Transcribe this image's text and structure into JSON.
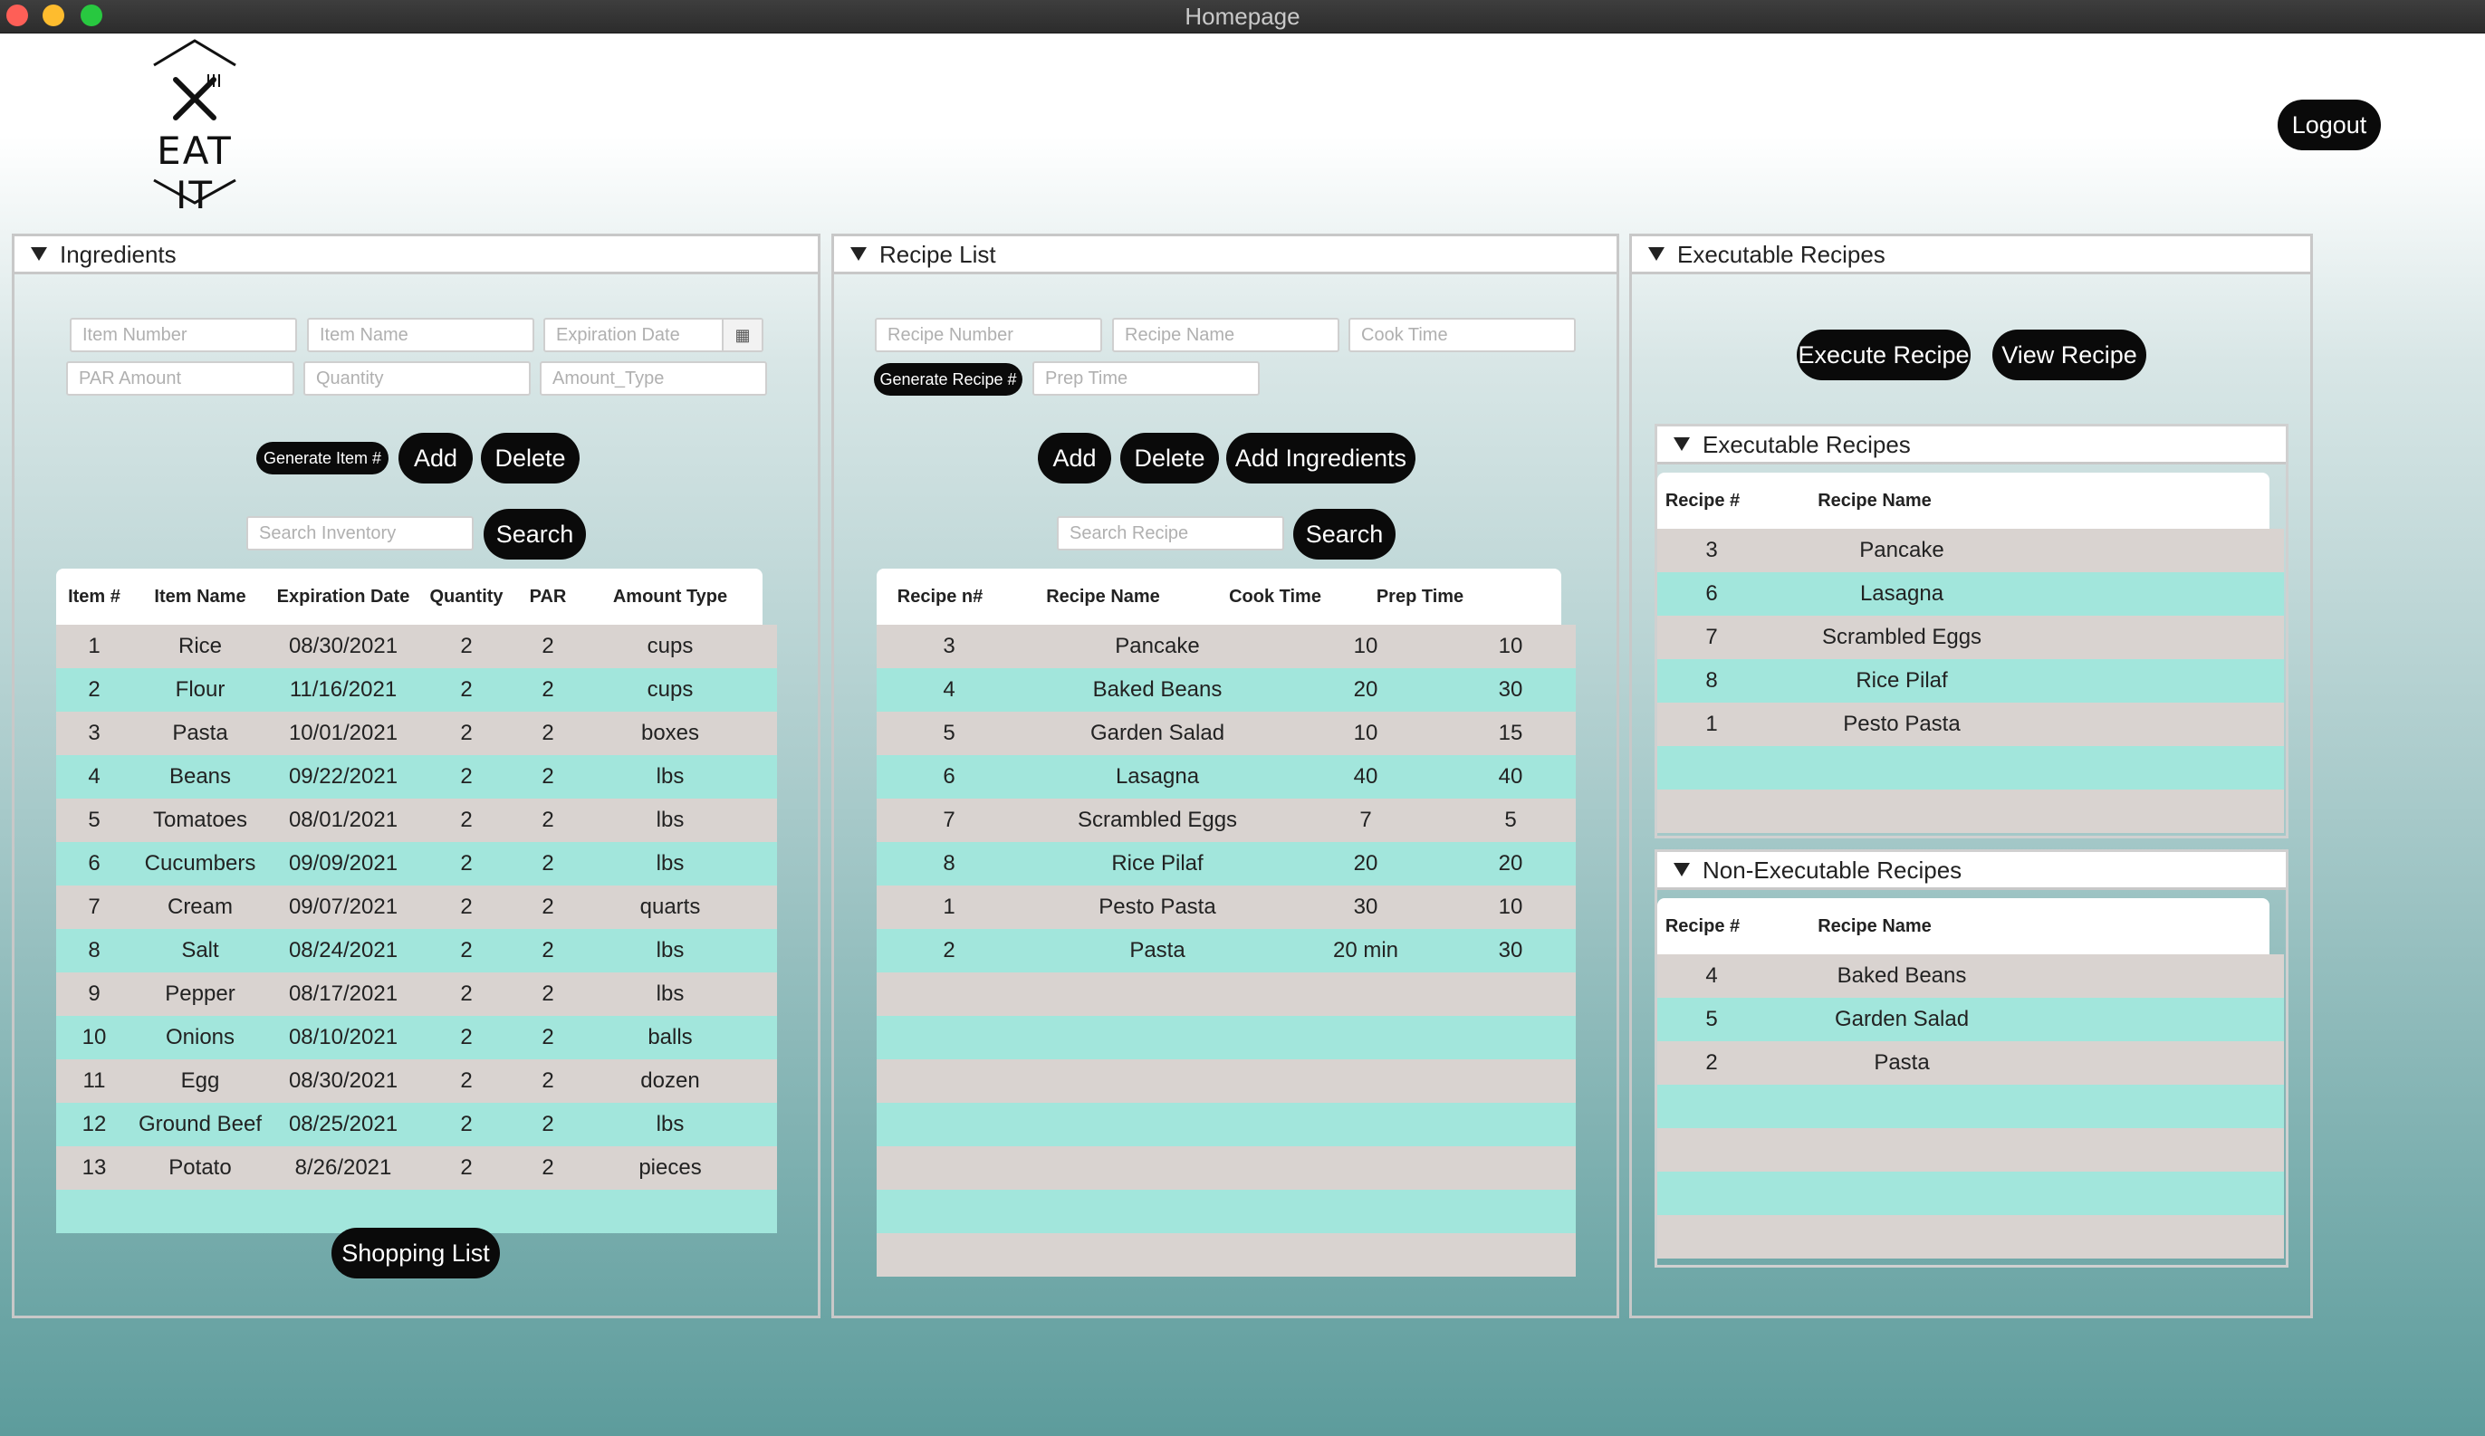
{
  "window": {
    "title": "Homepage"
  },
  "logo": {
    "text": "EAT  IT"
  },
  "header": {
    "logout_label": "Logout"
  },
  "ingredients": {
    "title": "Ingredients",
    "fields": {
      "item_number": "Item Number",
      "item_name": "Item Name",
      "expiration_date": "Expiration Date",
      "par_amount": "PAR Amount",
      "quantity": "Quantity",
      "amount_type": "Amount_Type"
    },
    "generate_label": "Generate Item #",
    "add_label": "Add",
    "delete_label": "Delete",
    "search_placeholder": "Search Inventory",
    "search_label": "Search",
    "shopping_list_label": "Shopping List",
    "columns": [
      "Item #",
      "Item Name",
      "Expiration Date",
      "Quantity",
      "PAR",
      "Amount Type"
    ],
    "rows": [
      [
        "1",
        "Rice",
        "08/30/2021",
        "2",
        "2",
        "cups"
      ],
      [
        "2",
        "Flour",
        "11/16/2021",
        "2",
        "2",
        "cups"
      ],
      [
        "3",
        "Pasta",
        "10/01/2021",
        "2",
        "2",
        "boxes"
      ],
      [
        "4",
        "Beans",
        "09/22/2021",
        "2",
        "2",
        "lbs"
      ],
      [
        "5",
        "Tomatoes",
        "08/01/2021",
        "2",
        "2",
        "lbs"
      ],
      [
        "6",
        "Cucumbers",
        "09/09/2021",
        "2",
        "2",
        "lbs"
      ],
      [
        "7",
        "Cream",
        "09/07/2021",
        "2",
        "2",
        "quarts"
      ],
      [
        "8",
        "Salt",
        "08/24/2021",
        "2",
        "2",
        "lbs"
      ],
      [
        "9",
        "Pepper",
        "08/17/2021",
        "2",
        "2",
        "lbs"
      ],
      [
        "10",
        "Onions",
        "08/10/2021",
        "2",
        "2",
        "balls"
      ],
      [
        "11",
        "Egg",
        "08/30/2021",
        "2",
        "2",
        "dozen"
      ],
      [
        "12",
        "Ground Beef",
        "08/25/2021",
        "2",
        "2",
        "lbs"
      ],
      [
        "13",
        "Potato",
        "8/26/2021",
        "2",
        "2",
        "pieces"
      ]
    ]
  },
  "recipes": {
    "title": "Recipe List",
    "fields": {
      "recipe_number": "Recipe Number",
      "recipe_name": "Recipe Name",
      "cook_time": "Cook Time",
      "prep_time": "Prep Time"
    },
    "generate_label": "Generate Recipe #",
    "add_label": "Add",
    "delete_label": "Delete",
    "add_ingredients_label": "Add Ingredients",
    "search_placeholder": "Search Recipe",
    "search_label": "Search",
    "columns": [
      "Recipe n#",
      "Recipe Name",
      "Cook Time",
      "Prep Time"
    ],
    "rows": [
      [
        "3",
        "Pancake",
        "10",
        "10"
      ],
      [
        "4",
        "Baked Beans",
        "20",
        "30"
      ],
      [
        "5",
        "Garden Salad",
        "10",
        "15"
      ],
      [
        "6",
        "Lasagna",
        "40",
        "40"
      ],
      [
        "7",
        "Scrambled Eggs",
        "7",
        "5"
      ],
      [
        "8",
        "Rice Pilaf",
        "20",
        "20"
      ],
      [
        "1",
        "Pesto Pasta",
        "30",
        "10"
      ],
      [
        "2",
        "Pasta",
        "20 min",
        "30"
      ]
    ]
  },
  "executable": {
    "title": "Executable Recipes",
    "execute_label": "Execute Recipe",
    "view_label": "View Recipe",
    "exec_sub": {
      "title": "Executable Recipes",
      "columns": [
        "Recipe #",
        "Recipe Name"
      ],
      "rows": [
        [
          "3",
          "Pancake"
        ],
        [
          "6",
          "Lasagna"
        ],
        [
          "7",
          "Scrambled Eggs"
        ],
        [
          "8",
          "Rice Pilaf"
        ],
        [
          "1",
          "Pesto Pasta"
        ]
      ]
    },
    "nonexec_sub": {
      "title": "Non-Executable Recipes",
      "columns": [
        "Recipe #",
        "Recipe Name"
      ],
      "rows": [
        [
          "4",
          "Baked Beans"
        ],
        [
          "5",
          "Garden Salad"
        ],
        [
          "2",
          "Pasta"
        ]
      ]
    }
  }
}
